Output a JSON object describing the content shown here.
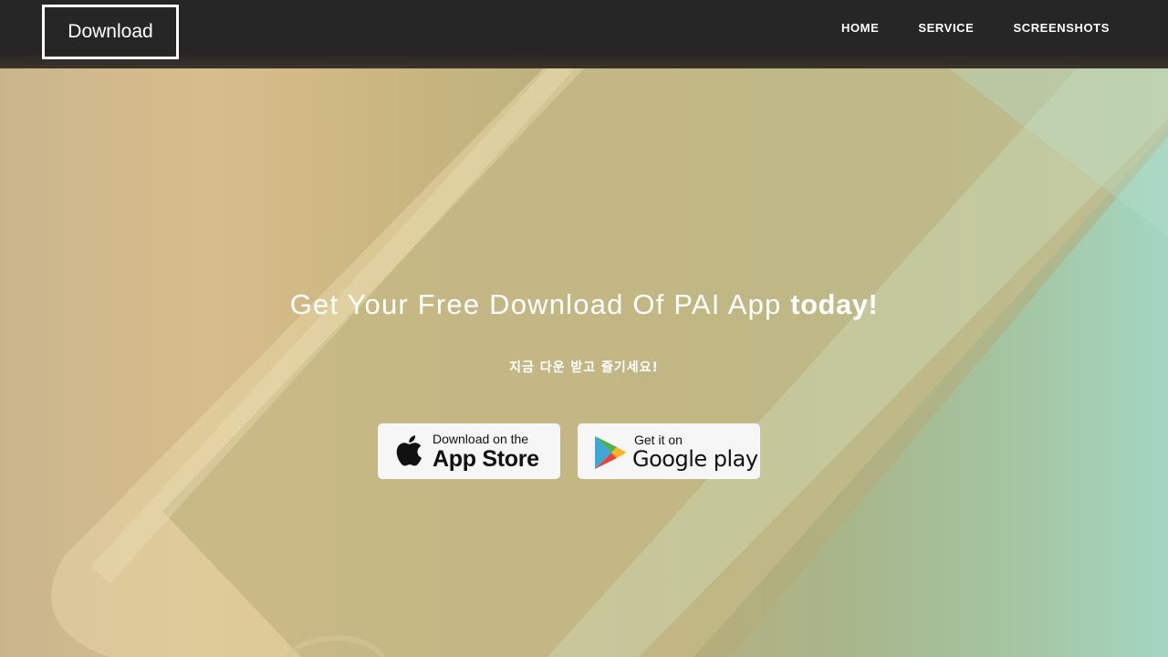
{
  "navbar": {
    "brand": "Download",
    "links": [
      {
        "label": "HOME"
      },
      {
        "label": "SERVICE"
      },
      {
        "label": "SCREENSHOTS"
      }
    ],
    "background": "#262626"
  },
  "hero": {
    "title_light": "Get Your Free Download Of PAI App ",
    "title_bold": "today!",
    "subtitle": "지금 다운 받고 즐기세요!",
    "buttons": {
      "app_store": {
        "small": "Download on the",
        "big": "App Store",
        "icon": "apple-icon"
      },
      "google_play": {
        "small": "Get it on",
        "big": "Google play",
        "icon": "google-play-icon"
      }
    }
  }
}
